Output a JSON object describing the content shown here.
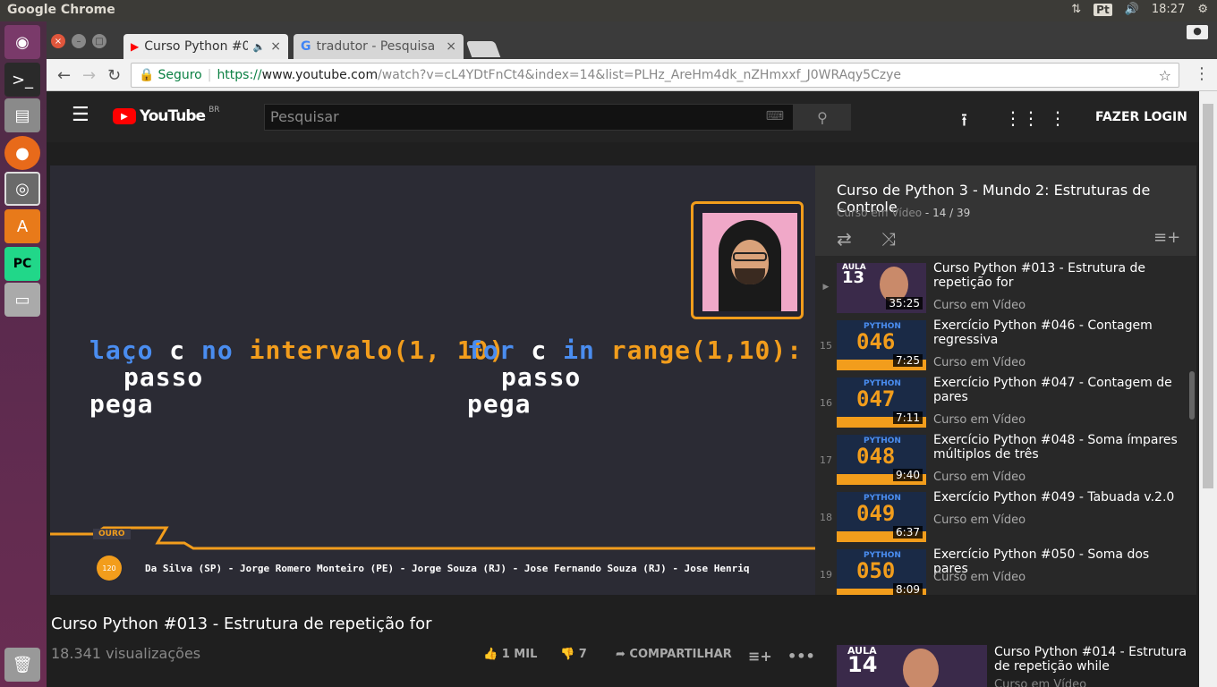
{
  "system": {
    "app_title": "Google Chrome",
    "lang": "Pt",
    "time": "18:27"
  },
  "tabs": [
    {
      "label": "Curso Python #0",
      "active": true
    },
    {
      "label": "tradutor - Pesquisa",
      "active": false
    }
  ],
  "omnibox": {
    "secure_label": "Seguro",
    "url_scheme": "https://",
    "url_host": "www.youtube.com",
    "url_path": "/watch?v=cL4YDtFnCt4&index=14&list=PLHz_AreHm4dk_nZHmxxf_J0WRAqy5Czye"
  },
  "youtube": {
    "logo_text": "YouTube",
    "region": "BR",
    "search_placeholder": "Pesquisar",
    "login_label": "FAZER LOGIN"
  },
  "video": {
    "code_left": {
      "l1a": "laço",
      "l1b": " c ",
      "l1c": "no",
      "l1d": " intervalo",
      "l1e": "(1, 10)",
      "l2": "passo",
      "l3": "pega"
    },
    "code_right": {
      "l1a": "for",
      "l1b": " c ",
      "l1c": "in",
      "l1d": " range",
      "l1e": "(1,10):",
      "l2": "passo",
      "l3": "pega"
    },
    "badge": "OURO",
    "medal": "120",
    "ticker": "Da Silva (SP) - Jorge Romero Monteiro (PE) - Jorge Souza (RJ) - Jose Fernando Souza (RJ) - Jose Henriq",
    "title": "Curso Python #013 - Estrutura de repetição for",
    "views": "18.341 visualizações",
    "likes": "1 MIL",
    "dislikes": "7",
    "share": "COMPARTILHAR"
  },
  "playlist": {
    "title": "Curso de Python 3 - Mundo 2: Estruturas de Controle",
    "channel": "Curso em Vídeo",
    "position": " - 14 / 39",
    "items": [
      {
        "index": "▶",
        "thumb_top": "AULA",
        "thumb_num": "13",
        "duration": "35:25",
        "title": "Curso Python #013 - Estrutura de repetição for",
        "channel": "Curso em Vídeo"
      },
      {
        "index": "15",
        "thumb_top": "PYTHON",
        "thumb_num": "046",
        "duration": "7:25",
        "title": "Exercício Python #046 - Contagem regressiva",
        "channel": "Curso em Vídeo"
      },
      {
        "index": "16",
        "thumb_top": "PYTHON",
        "thumb_num": "047",
        "duration": "7:11",
        "title": "Exercício Python #047 - Contagem de pares",
        "channel": "Curso em Vídeo"
      },
      {
        "index": "17",
        "thumb_top": "PYTHON",
        "thumb_num": "048",
        "duration": "9:40",
        "title": "Exercício Python #048 - Soma ímpares múltiplos de três",
        "channel": "Curso em Vídeo"
      },
      {
        "index": "18",
        "thumb_top": "PYTHON",
        "thumb_num": "049",
        "duration": "6:37",
        "title": "Exercício Python #049 - Tabuada v.2.0",
        "channel": "Curso em Vídeo"
      },
      {
        "index": "19",
        "thumb_top": "PYTHON",
        "thumb_num": "050",
        "duration": "8:09",
        "title": "Exercício Python #050 - Soma dos pares",
        "channel": "Curso em Vídeo"
      }
    ]
  },
  "next_up": {
    "thumb_top": "AULA",
    "thumb_num": "14",
    "title": "Curso Python #014 - Estrutura de repetição while",
    "channel": "Curso em Vídeo"
  },
  "colors": {
    "accent_orange": "#f29d1c",
    "accent_blue": "#4a8df0",
    "youtube_red": "#ff0000"
  }
}
